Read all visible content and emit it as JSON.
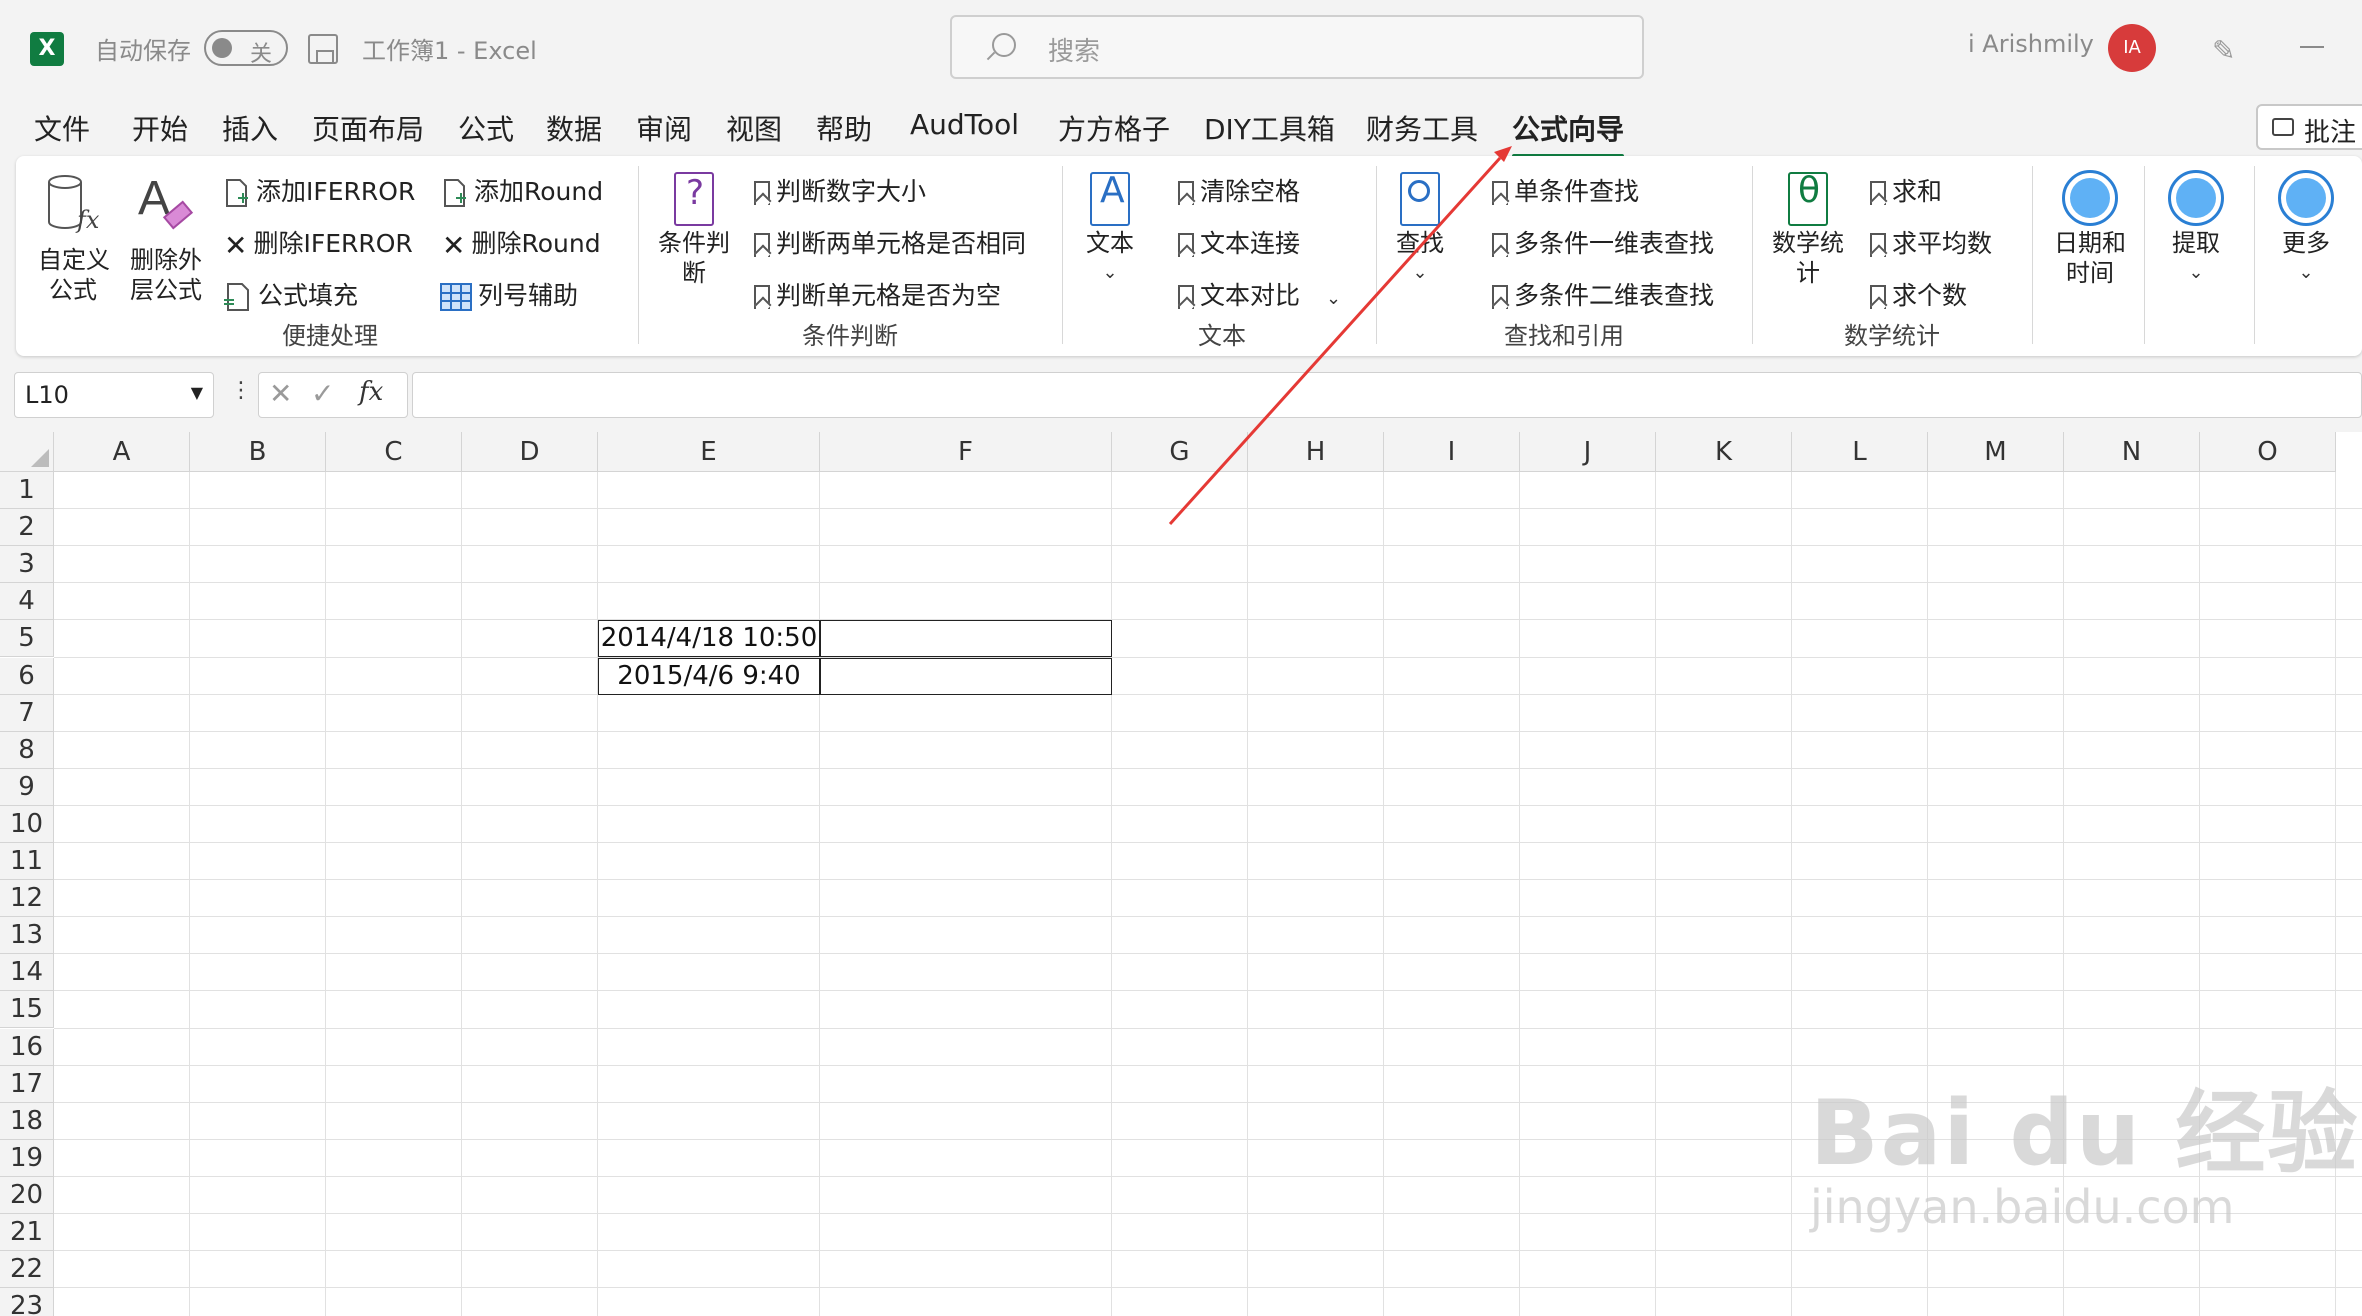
{
  "titlebar": {
    "app_logo": "X",
    "autosave_label": "自动保存",
    "autosave_state": "关",
    "doc_title": "工作簿1  -  Excel",
    "search_placeholder": "搜索",
    "user_name": "i Arishmily",
    "avatar_initials": "IA"
  },
  "menu": {
    "tabs": [
      "文件",
      "开始",
      "插入",
      "页面布局",
      "公式",
      "数据",
      "审阅",
      "视图",
      "帮助",
      "AudTool",
      "方方格子",
      "DIY工具箱",
      "财务工具",
      "公式向导"
    ],
    "active_tab": "公式向导",
    "comment_button": "批注"
  },
  "ribbon": {
    "custom_formula": "自定义\n公式",
    "remove_outer": "删除外\n层公式",
    "add_iferror": "添加IFERROR",
    "del_iferror": "删除IFERROR",
    "formula_fill": "公式填充",
    "add_round": "添加Round",
    "del_round": "删除Round",
    "col_helper": "列号辅助",
    "group_convenient": "便捷处理",
    "cond_judge": "条件判\n断",
    "judge_num": "判断数字大小",
    "judge_same": "判断两单元格是否相同",
    "judge_empty": "判断单元格是否为空",
    "group_cond": "条件判断",
    "text_big": "文本",
    "clear_space": "清除空格",
    "text_concat": "文本连接",
    "text_compare": "文本对比",
    "group_text": "文本",
    "find_big": "查找",
    "single_find": "单条件查找",
    "multi_1d": "多条件一维表查找",
    "multi_2d": "多条件二维表查找",
    "group_find": "查找和引用",
    "math_big": "数学统\n计",
    "sum": "求和",
    "average": "求平均数",
    "count": "求个数",
    "group_math": "数学统计",
    "datetime": "日期和\n时间",
    "extract": "提取",
    "more": "更多"
  },
  "formula_bar": {
    "name_box": "L10",
    "fx": "fx",
    "value": ""
  },
  "sheet": {
    "columns": [
      "A",
      "B",
      "C",
      "D",
      "E",
      "F",
      "G",
      "H",
      "I",
      "J",
      "K",
      "L",
      "M",
      "N",
      "O"
    ],
    "rows": [
      "1",
      "2",
      "3",
      "4",
      "5",
      "6",
      "7",
      "8",
      "9",
      "10",
      "11",
      "12",
      "13",
      "14",
      "15",
      "16",
      "17",
      "18",
      "19",
      "20",
      "21",
      "22",
      "23"
    ],
    "cells": {
      "E5": "2014/4/18 10:50",
      "E6": "2015/4/6 9:40",
      "F5": "",
      "F6": ""
    }
  },
  "watermark": {
    "brand": "Bai du 经验",
    "url": "jingyan.baidu.com"
  },
  "colors": {
    "excel_green": "#107c41",
    "arrow_red": "#e53935",
    "avatar_red": "#d73b3b"
  }
}
